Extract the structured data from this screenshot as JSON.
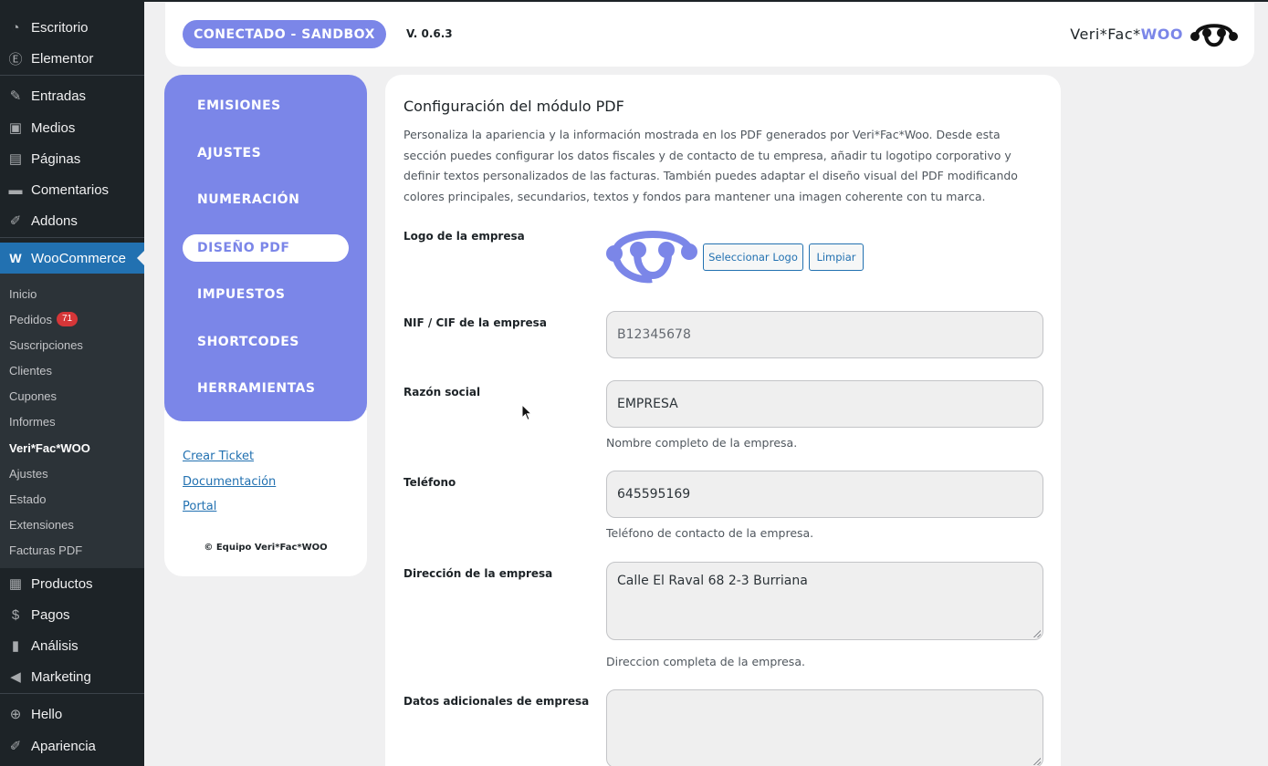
{
  "wp_menu": {
    "items": [
      {
        "label": "Escritorio",
        "icon": "dashboard-icon"
      },
      {
        "label": "Elementor",
        "icon": "elementor-icon"
      },
      {
        "label": "Entradas",
        "icon": "pin-icon"
      },
      {
        "label": "Medios",
        "icon": "media-icon"
      },
      {
        "label": "Páginas",
        "icon": "page-icon"
      },
      {
        "label": "Comentarios",
        "icon": "comment-icon"
      },
      {
        "label": "Addons",
        "icon": "addons-icon"
      },
      {
        "label": "WooCommerce",
        "icon": "woocommerce-icon"
      },
      {
        "label": "Productos",
        "icon": "products-icon"
      },
      {
        "label": "Pagos",
        "icon": "payments-icon"
      },
      {
        "label": "Análisis",
        "icon": "analytics-icon"
      },
      {
        "label": "Marketing",
        "icon": "megaphone-icon"
      },
      {
        "label": "Hello",
        "icon": "plus-circle-icon"
      },
      {
        "label": "Apariencia",
        "icon": "brush-icon"
      }
    ],
    "woo_submenu": [
      {
        "label": "Inicio"
      },
      {
        "label": "Pedidos",
        "badge": "71"
      },
      {
        "label": "Suscripciones"
      },
      {
        "label": "Clientes"
      },
      {
        "label": "Cupones"
      },
      {
        "label": "Informes"
      },
      {
        "label": "Veri*Fac*WOO"
      },
      {
        "label": "Ajustes"
      },
      {
        "label": "Estado"
      },
      {
        "label": "Extensiones"
      },
      {
        "label": "Facturas PDF"
      }
    ]
  },
  "header": {
    "status": "CONECTADO - SANDBOX",
    "version": "V. 0.6.3",
    "brand_prefix": "Veri*Fac*",
    "brand_suffix": "WOO",
    "accent_color": "#7b86e8"
  },
  "nav": {
    "items": [
      {
        "label": "EMISIONES"
      },
      {
        "label": "AJUSTES"
      },
      {
        "label": "NUMERACIÓN"
      },
      {
        "label": "DISEÑO PDF",
        "active": true
      },
      {
        "label": "IMPUESTOS"
      },
      {
        "label": "SHORTCODES"
      },
      {
        "label": "HERRAMIENTAS"
      }
    ],
    "links": [
      {
        "label": "Crear Ticket"
      },
      {
        "label": "Documentación"
      },
      {
        "label": "Portal"
      }
    ],
    "copyright": "© Equipo Veri*Fac*WOO"
  },
  "main": {
    "title": "Configuración del módulo PDF",
    "description": "Personaliza la apariencia y la información mostrada en los PDF generados por Veri*Fac*Woo. Desde esta sección puedes configurar los datos fiscales y de contacto de tu empresa, añadir tu logotipo corporativo y definir textos personalizados de las facturas. También puedes adaptar el diseño visual del PDF modificando colores principales, secundarios, textos y fondos para mantener una imagen coherente con tu marca.",
    "logo": {
      "label": "Logo de la empresa",
      "select_button": "Seleccionar Logo",
      "clear_button": "Limpiar"
    },
    "fields": {
      "nif": {
        "label": "NIF / CIF de la empresa",
        "placeholder": "B12345678",
        "value": ""
      },
      "razon": {
        "label": "Razón social",
        "value": "EMPRESA",
        "help": "Nombre completo de la empresa."
      },
      "telefono": {
        "label": "Teléfono",
        "value": "645595169",
        "help": "Teléfono de contacto de la empresa."
      },
      "direccion": {
        "label": "Dirección de la empresa",
        "value": "Calle El Raval 68 2-3 Burriana",
        "help": "Direccion completa de la empresa."
      },
      "adicionales": {
        "label": "Datos adicionales de empresa",
        "value": ""
      }
    }
  }
}
